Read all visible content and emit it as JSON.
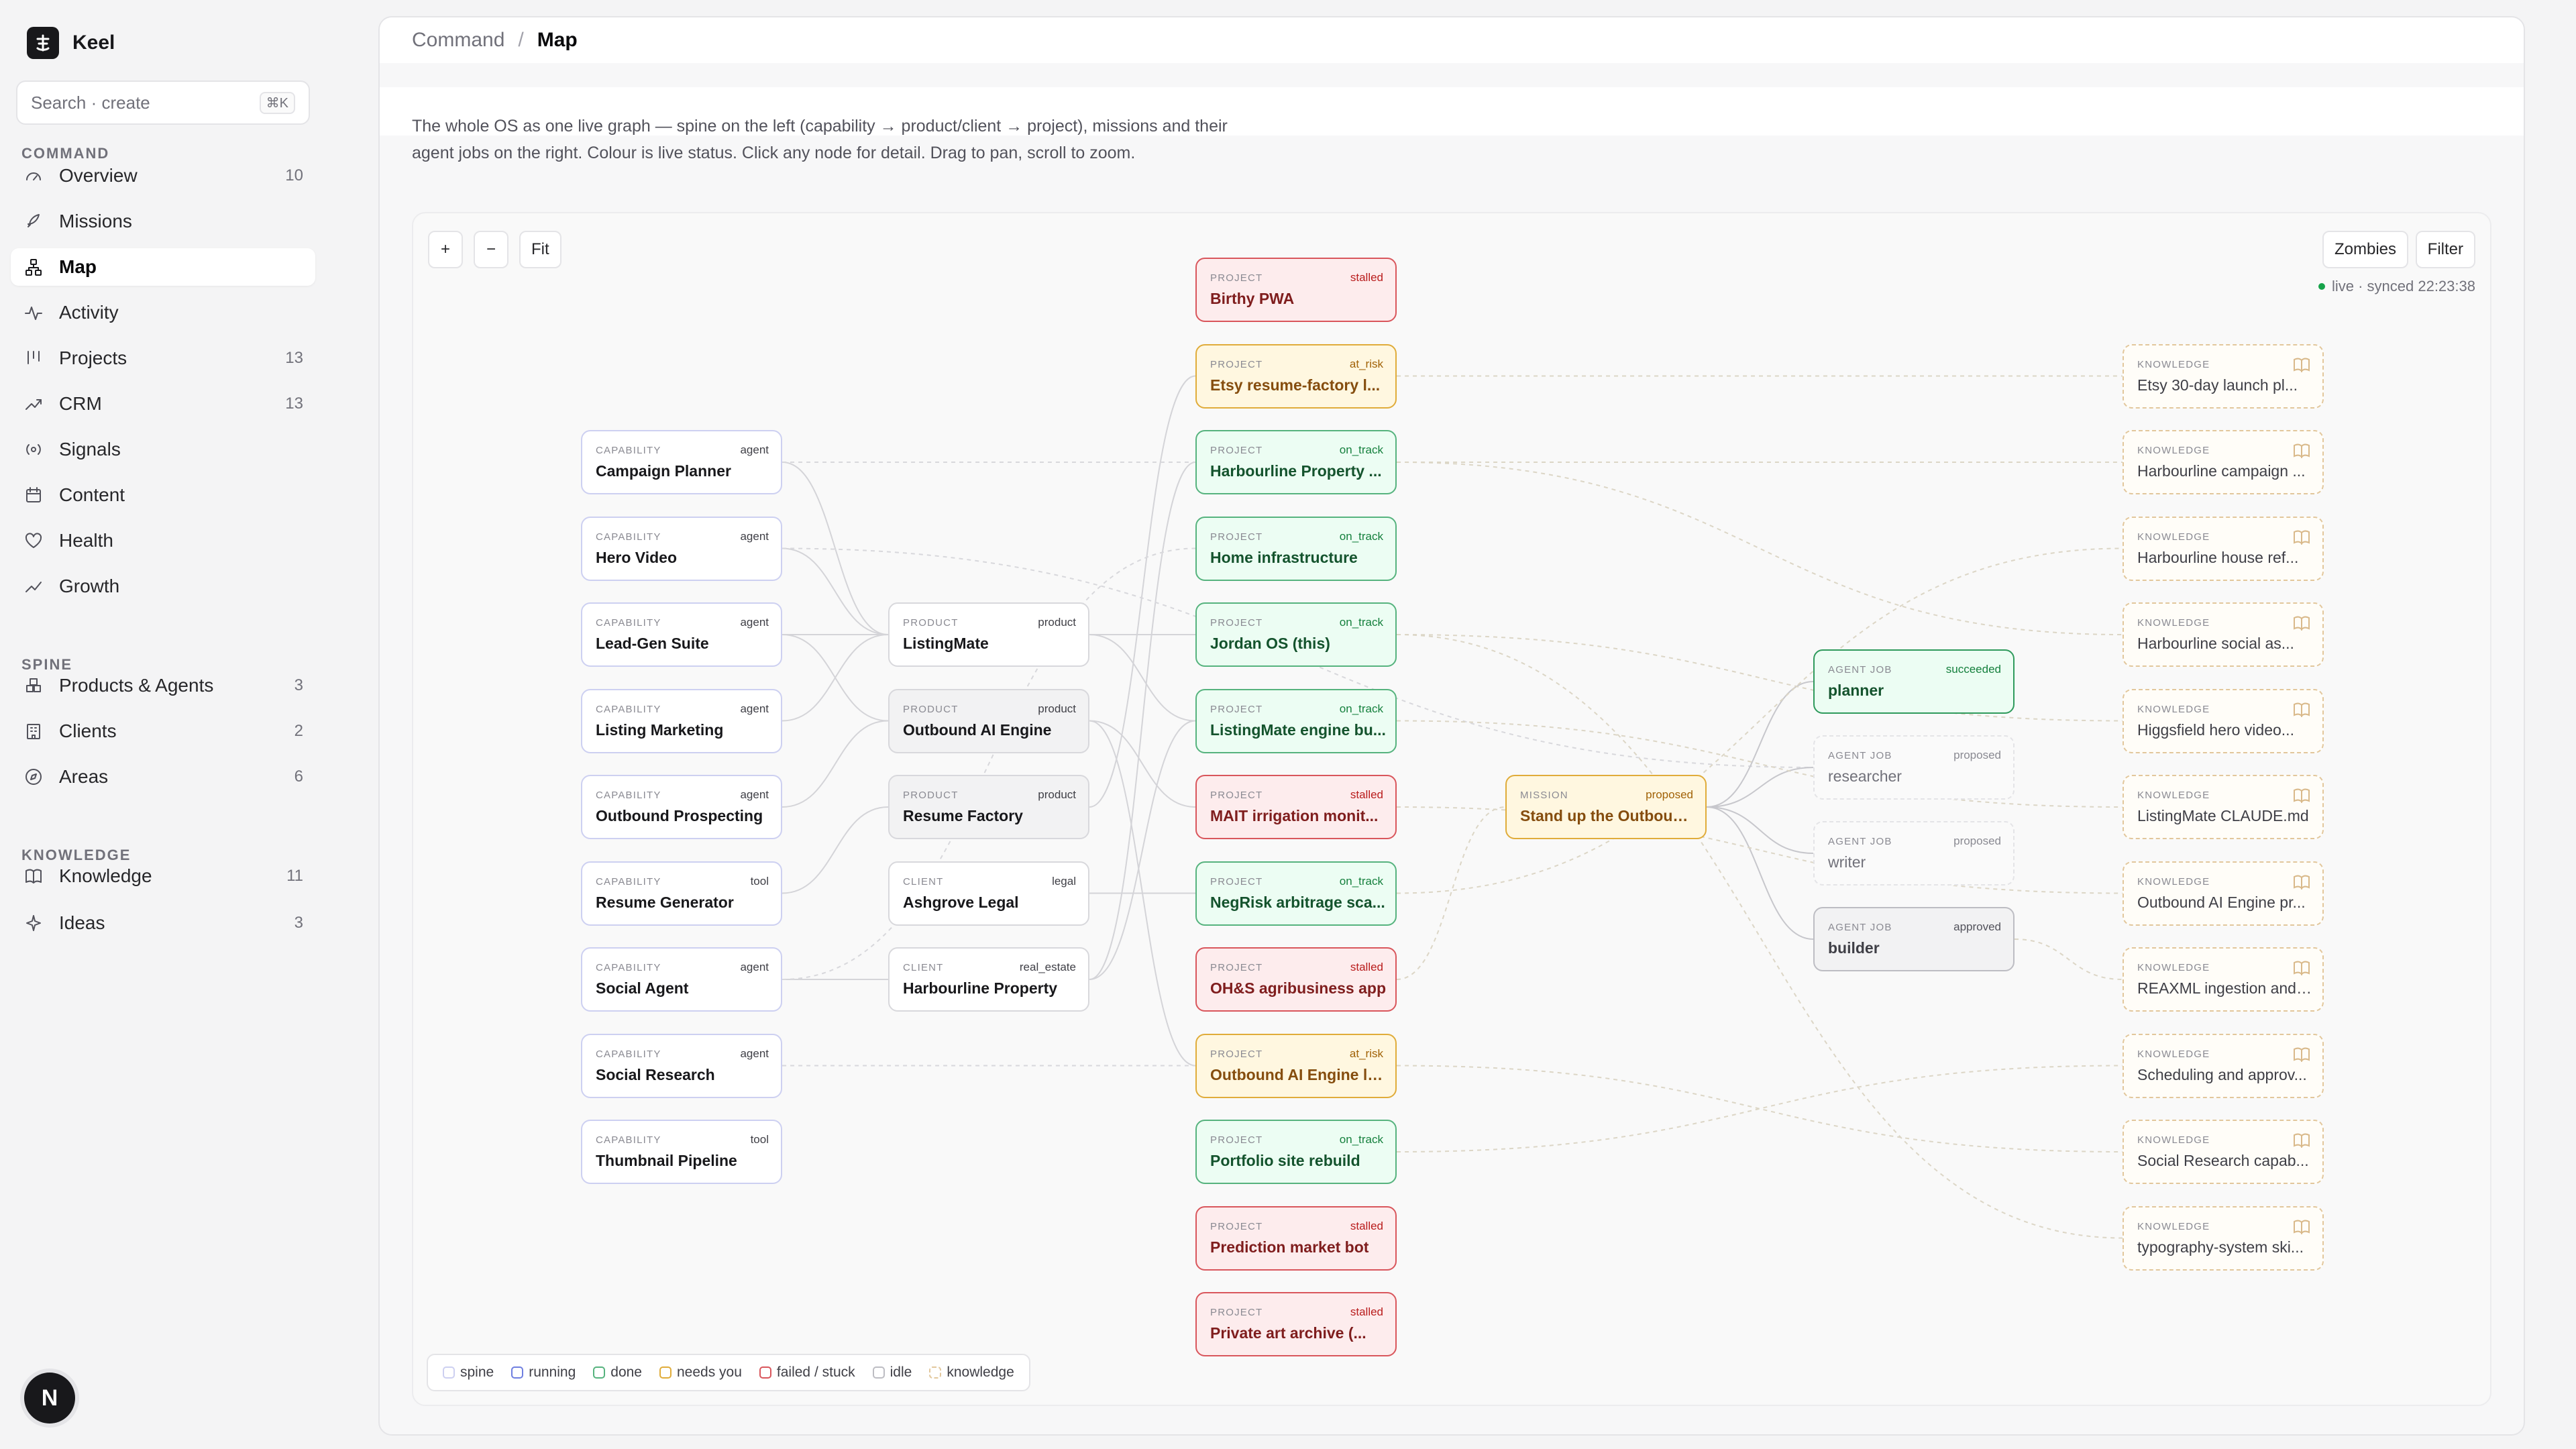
{
  "app": {
    "name": "Keel"
  },
  "search": {
    "placeholder": "Search · create",
    "shortcut": "⌘K"
  },
  "sidebar": {
    "sections": [
      "COMMAND",
      "SPINE",
      "KNOWLEDGE"
    ],
    "items": [
      {
        "label": "Overview",
        "count": "10",
        "icon": "gauge-icon"
      },
      {
        "label": "Missions",
        "count": "",
        "icon": "rocket-icon"
      },
      {
        "label": "Map",
        "count": "",
        "icon": "network-icon",
        "active": true
      },
      {
        "label": "Activity",
        "count": "",
        "icon": "pulse-icon"
      },
      {
        "label": "Projects",
        "count": "13",
        "icon": "kanban-icon"
      },
      {
        "label": "CRM",
        "count": "13",
        "icon": "trend-icon"
      },
      {
        "label": "Signals",
        "count": "",
        "icon": "signal-icon"
      },
      {
        "label": "Content",
        "count": "",
        "icon": "calendar-icon"
      },
      {
        "label": "Health",
        "count": "",
        "icon": "heart-icon"
      },
      {
        "label": "Growth",
        "count": "",
        "icon": "growth-icon"
      },
      {
        "label": "Products & Agents",
        "count": "3",
        "icon": "boxes-icon"
      },
      {
        "label": "Clients",
        "count": "2",
        "icon": "building-icon"
      },
      {
        "label": "Areas",
        "count": "6",
        "icon": "compass-icon"
      },
      {
        "label": "Knowledge",
        "count": "11",
        "icon": "book-icon"
      },
      {
        "label": "Ideas",
        "count": "3",
        "icon": "sparkle-icon"
      }
    ]
  },
  "user": {
    "initial": "N"
  },
  "header": {
    "crumb_parent": "Command",
    "crumb_sep": "/",
    "crumb_current": "Map"
  },
  "description": "The whole OS as one live graph — spine on the left (capability → product/client → project), missions and their agent jobs on the right. Colour is live status. Click any node for detail. Drag to pan, scroll to zoom.",
  "controls": {
    "zoom_in": "+",
    "zoom_out": "−",
    "fit": "Fit",
    "zombies": "Zombies",
    "filter": "Filter"
  },
  "sync": {
    "text": "live · synced 22:23:38"
  },
  "legend": [
    {
      "label": "spine",
      "color": "#cdd0f1"
    },
    {
      "label": "running",
      "color": "#6f7fe0"
    },
    {
      "label": "done",
      "color": "#56b37e"
    },
    {
      "label": "needs you",
      "color": "#e0ac3a"
    },
    {
      "label": "failed / stuck",
      "color": "#d9565c"
    },
    {
      "label": "idle",
      "color": "#bdbdc3"
    },
    {
      "label": "knowledge",
      "color": "#e2c79c"
    }
  ],
  "graph": {
    "capabilities": [
      {
        "kind": "CAPABILITY",
        "tag": "agent",
        "title": "Campaign Planner"
      },
      {
        "kind": "CAPABILITY",
        "tag": "agent",
        "title": "Hero Video"
      },
      {
        "kind": "CAPABILITY",
        "tag": "agent",
        "title": "Lead-Gen Suite"
      },
      {
        "kind": "CAPABILITY",
        "tag": "agent",
        "title": "Listing Marketing"
      },
      {
        "kind": "CAPABILITY",
        "tag": "agent",
        "title": "Outbound Prospecting"
      },
      {
        "kind": "CAPABILITY",
        "tag": "tool",
        "title": "Resume Generator"
      },
      {
        "kind": "CAPABILITY",
        "tag": "agent",
        "title": "Social Agent"
      },
      {
        "kind": "CAPABILITY",
        "tag": "agent",
        "title": "Social Research"
      },
      {
        "kind": "CAPABILITY",
        "tag": "tool",
        "title": "Thumbnail Pipeline"
      }
    ],
    "products": [
      {
        "kind": "PRODUCT",
        "tag": "product",
        "title": "ListingMate"
      },
      {
        "kind": "PRODUCT",
        "tag": "product",
        "title": "Outbound AI Engine"
      },
      {
        "kind": "PRODUCT",
        "tag": "product",
        "title": "Resume Factory"
      },
      {
        "kind": "CLIENT",
        "tag": "legal",
        "title": "Ashgrove Legal"
      },
      {
        "kind": "CLIENT",
        "tag": "real_estate",
        "title": "Harbourline Property"
      }
    ],
    "projects": [
      {
        "kind": "PROJECT",
        "tag": "stalled",
        "title": "Birthy PWA"
      },
      {
        "kind": "PROJECT",
        "tag": "at_risk",
        "title": "Etsy resume-factory l..."
      },
      {
        "kind": "PROJECT",
        "tag": "on_track",
        "title": "Harbourline Property ..."
      },
      {
        "kind": "PROJECT",
        "tag": "on_track",
        "title": "Home infrastructure"
      },
      {
        "kind": "PROJECT",
        "tag": "on_track",
        "title": "Jordan OS (this)"
      },
      {
        "kind": "PROJECT",
        "tag": "on_track",
        "title": "ListingMate engine bu..."
      },
      {
        "kind": "PROJECT",
        "tag": "stalled",
        "title": "MAIT irrigation monit..."
      },
      {
        "kind": "PROJECT",
        "tag": "on_track",
        "title": "NegRisk arbitrage sca..."
      },
      {
        "kind": "PROJECT",
        "tag": "stalled",
        "title": "OH&S agribusiness app"
      },
      {
        "kind": "PROJECT",
        "tag": "at_risk",
        "title": "Outbound AI Engine la..."
      },
      {
        "kind": "PROJECT",
        "tag": "on_track",
        "title": "Portfolio site rebuild"
      },
      {
        "kind": "PROJECT",
        "tag": "stalled",
        "title": "Prediction market bot"
      },
      {
        "kind": "PROJECT",
        "tag": "stalled",
        "title": "Private art archive (..."
      }
    ],
    "mission": {
      "kind": "MISSION",
      "tag": "proposed",
      "title": "Stand up the Outbound..."
    },
    "jobs": [
      {
        "kind": "AGENT JOB",
        "tag": "succeeded",
        "title": "planner"
      },
      {
        "kind": "AGENT JOB",
        "tag": "proposed",
        "title": "researcher"
      },
      {
        "kind": "AGENT JOB",
        "tag": "proposed",
        "title": "writer"
      },
      {
        "kind": "AGENT JOB",
        "tag": "approved",
        "title": "builder"
      }
    ],
    "knowledge": [
      {
        "kind": "KNOWLEDGE",
        "title": "Etsy 30-day launch pl..."
      },
      {
        "kind": "KNOWLEDGE",
        "title": "Harbourline campaign ..."
      },
      {
        "kind": "KNOWLEDGE",
        "title": "Harbourline house ref..."
      },
      {
        "kind": "KNOWLEDGE",
        "title": "Harbourline social as..."
      },
      {
        "kind": "KNOWLEDGE",
        "title": "Higgsfield hero video..."
      },
      {
        "kind": "KNOWLEDGE",
        "title": "ListingMate CLAUDE.md"
      },
      {
        "kind": "KNOWLEDGE",
        "title": "Outbound AI Engine pr..."
      },
      {
        "kind": "KNOWLEDGE",
        "title": "REAXML ingestion and ..."
      },
      {
        "kind": "KNOWLEDGE",
        "title": "Scheduling and approv..."
      },
      {
        "kind": "KNOWLEDGE",
        "title": "Social Research capab..."
      },
      {
        "kind": "KNOWLEDGE",
        "title": "typography-system ski..."
      }
    ]
  }
}
